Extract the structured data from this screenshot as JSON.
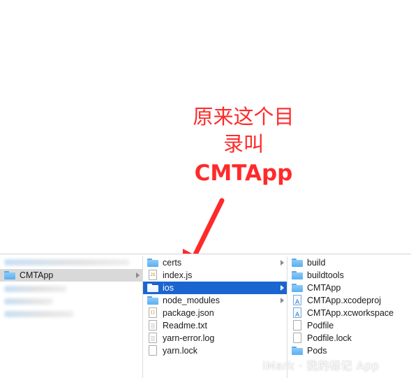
{
  "annotation": {
    "line1": "原来这个目",
    "line2": "录叫",
    "line3": "CMTApp",
    "color": "#ff2a2a"
  },
  "finder": {
    "column1": {
      "selected_item": "CMTApp"
    },
    "column2": {
      "items": [
        {
          "label": "certs",
          "icon": "folder-icon",
          "has_children": true
        },
        {
          "label": "index.js",
          "icon": "js-file-icon",
          "has_children": false
        },
        {
          "label": "ios",
          "icon": "folder-icon",
          "has_children": true,
          "selected": true
        },
        {
          "label": "node_modules",
          "icon": "folder-icon",
          "has_children": true
        },
        {
          "label": "package.json",
          "icon": "json-file-icon",
          "has_children": false
        },
        {
          "label": "Readme.txt",
          "icon": "text-file-icon",
          "has_children": false
        },
        {
          "label": "yarn-error.log",
          "icon": "text-file-icon",
          "has_children": false
        },
        {
          "label": "yarn.lock",
          "icon": "file-icon",
          "has_children": false
        }
      ]
    },
    "column3": {
      "items": [
        {
          "label": "build",
          "icon": "folder-icon",
          "has_children": true
        },
        {
          "label": "buildtools",
          "icon": "folder-icon",
          "has_children": true
        },
        {
          "label": "CMTApp",
          "icon": "folder-icon",
          "has_children": true
        },
        {
          "label": "CMTApp.xcodeproj",
          "icon": "xcodeproj-icon",
          "has_children": false
        },
        {
          "label": "CMTApp.xcworkspace",
          "icon": "xcworkspace-icon",
          "has_children": false
        },
        {
          "label": "Podfile",
          "icon": "file-icon",
          "has_children": false
        },
        {
          "label": "Podfile.lock",
          "icon": "file-icon",
          "has_children": false
        },
        {
          "label": "Pods",
          "icon": "folder-icon",
          "has_children": true
        }
      ]
    },
    "selection_color": "#1b65d0"
  },
  "watermark": "iMark · 我的标记 App"
}
